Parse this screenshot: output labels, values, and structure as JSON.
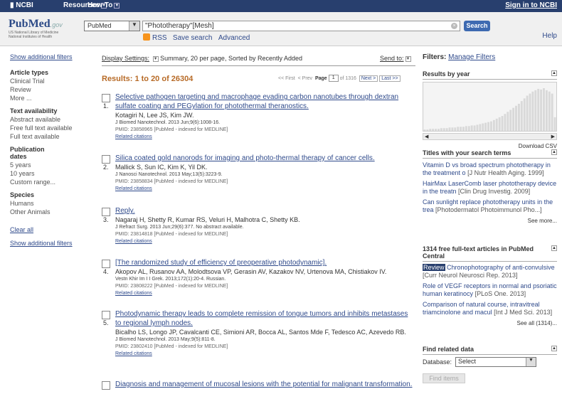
{
  "topbar": {
    "ncbi": "NCBI",
    "resources": "Resources",
    "howto": "How To",
    "signin": "Sign in to NCBI"
  },
  "logo": {
    "pub": "Pub",
    "med": "Med",
    "gov": ".gov",
    "sub1": "US National Library of Medicine",
    "sub2": "National Institutes of Health"
  },
  "search": {
    "db": "PubMed",
    "query": "\"Phototherapy\"[Mesh]",
    "button": "Search",
    "rss": "RSS",
    "save": "Save search",
    "advanced": "Advanced",
    "help": "Help"
  },
  "left": {
    "show_filters": "Show additional filters",
    "groups": [
      {
        "heading": "Article types",
        "items": [
          "Clinical Trial",
          "Review",
          "More ..."
        ]
      },
      {
        "heading": "Text availability",
        "items": [
          "Abstract available",
          "Free full text available",
          "Full text available"
        ]
      },
      {
        "heading": "Publication dates",
        "items": [
          "5 years",
          "10 years",
          "Custom range..."
        ]
      },
      {
        "heading": "Species",
        "items": [
          "Humans",
          "Other Animals"
        ]
      }
    ],
    "clear_all": "Clear all",
    "show_filters2": "Show additional filters"
  },
  "display": {
    "label": "Display Settings:",
    "value": "Summary, 20 per page, Sorted by Recently Added",
    "send_to": "Send to:"
  },
  "results": {
    "count": "Results: 1 to 20 of 26304",
    "first": "<< First",
    "prev": "< Prev",
    "page_label": "Page",
    "page": "1",
    "of": "of 1316",
    "next": "Next >",
    "last": "Last >>"
  },
  "items": [
    {
      "num": "1.",
      "title": "Selective pathogen targeting and macrophage evading carbon nanotubes through dextran sulfate coating and PEGylation for photothermal theranostics.",
      "authors": "Kotagiri N, Lee JS, Kim JW.",
      "journal": "J Biomed Nanotechnol. 2013 Jun;9(6):1008-16.",
      "pmid": "PMID: 23858965 [PubMed - indexed for MEDLINE]",
      "related": "Related citations"
    },
    {
      "num": "2.",
      "title": "Silica coated gold nanorods for imaging and photo-thermal therapy of cancer cells.",
      "authors": "Mallick S, Sun IC, Kim K, Yil DK.",
      "journal": "J Nanosci Nanotechnol. 2013 May;13(5):3223-9.",
      "pmid": "PMID: 23858834 [PubMed - indexed for MEDLINE]",
      "related": "Related citations"
    },
    {
      "num": "3.",
      "title": "Reply.",
      "authors": "Nagaraj H, Shetty R, Kumar RS, Veluri H, Malhotra C, Shetty KB.",
      "journal": "J Refract Surg. 2013 Jun;29(6):377. No abstract available.",
      "pmid": "PMID: 23814818 [PubMed - indexed for MEDLINE]",
      "related": "Related citations"
    },
    {
      "num": "4.",
      "title": "[The randomized study of efficiency of preoperative photodynamic].",
      "authors": "Akopov AL, Rusanov AA, Molodtsova VP, Gerasin AV, Kazakov NV, Urtenova MA, Chistiakov IV.",
      "journal": "Vestn Khir Im I I Grek. 2013;172(1):20-4. Russian.",
      "pmid": "PMID: 23808222 [PubMed - indexed for MEDLINE]",
      "related": "Related citations"
    },
    {
      "num": "5.",
      "title": "Photodynamic therapy leads to complete remission of tongue tumors and inhibits metastases to regional lymph nodes.",
      "authors": "Bicalho LS, Longo JP, Cavalcanti CE, Simioni AR, Bocca AL, Santos Mde F, Tedesco AC, Azevedo RB.",
      "journal": "J Biomed Nanotechnol. 2013 May;9(5):811-8.",
      "pmid": "PMID: 23802410 [PubMed - indexed for MEDLINE]",
      "related": "Related citations"
    },
    {
      "num": "6.",
      "title": "Diagnosis and management of mucosal lesions with the potential for malignant transformation.",
      "authors": "",
      "journal": "",
      "pmid": "",
      "related": ""
    }
  ],
  "right": {
    "filters_label": "Filters:",
    "manage": "Manage Filters",
    "by_year": "Results by year",
    "download_csv": "Download CSV",
    "titles_head": "Titles with your search terms",
    "titles": [
      {
        "text": "Vitamin D vs broad spectrum phototherapy in the treatment o",
        "src": "[J Nutr Health Aging. 1999]"
      },
      {
        "text": "HairMax LaserComb laser phototherapy device in the treatn",
        "src": "[Clin Drug Investig. 2009]"
      },
      {
        "text": "Can sunlight replace phototherapy units in the trea",
        "src": "[Photodermatol Photoimmunol Pho...]"
      }
    ],
    "see_more": "See more...",
    "free_head": "1314 free full-text articles in PubMed Central",
    "free": [
      {
        "badge": "Review",
        "text": "Chronophotography of anti-convulsive",
        "src": "[Curr Neurol Neurosci Rep. 2013]"
      },
      {
        "badge": "",
        "text": "Role of VEGF receptors in normal and psoriatic human keratinocy",
        "src": "[PLoS One. 2013]"
      },
      {
        "badge": "",
        "text": "Comparison of natural course, intravitreal triamcinolone and macul",
        "src": "[Int J Med Sci. 2013]"
      }
    ],
    "see_all": "See all (1314)...",
    "find_head": "Find related data",
    "database_label": "Database:",
    "database_value": "Select",
    "find_button": "Find items"
  },
  "chart_data": {
    "type": "bar",
    "title": "Results by year",
    "values": [
      2,
      2,
      3,
      3,
      3,
      3,
      4,
      4,
      4,
      5,
      5,
      5,
      6,
      6,
      6,
      7,
      7,
      8,
      8,
      9,
      10,
      11,
      12,
      13,
      14,
      16,
      18,
      20,
      22,
      25,
      28,
      31,
      34,
      37,
      40,
      44,
      48,
      52,
      55,
      58,
      60,
      62,
      61,
      63,
      60,
      58,
      55,
      20
    ],
    "colors": {
      "bar": "#d9d9d9",
      "accent": "#2f4a8b"
    }
  }
}
